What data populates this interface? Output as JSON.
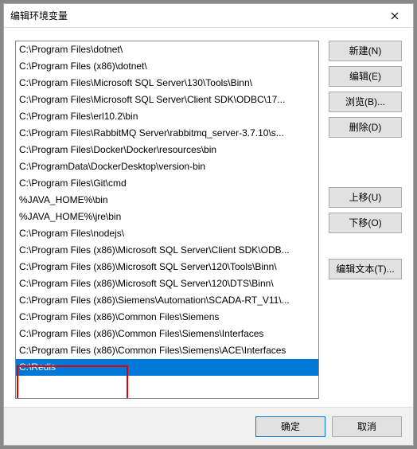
{
  "dialog": {
    "title": "编辑环境变量",
    "close_label": "×"
  },
  "entries": [
    "C:\\Program Files\\dotnet\\",
    "C:\\Program Files (x86)\\dotnet\\",
    "C:\\Program Files\\Microsoft SQL Server\\130\\Tools\\Binn\\",
    "C:\\Program Files\\Microsoft SQL Server\\Client SDK\\ODBC\\17...",
    "C:\\Program Files\\erl10.2\\bin",
    "C:\\Program Files\\RabbitMQ Server\\rabbitmq_server-3.7.10\\s...",
    "C:\\Program Files\\Docker\\Docker\\resources\\bin",
    "C:\\ProgramData\\DockerDesktop\\version-bin",
    "C:\\Program Files\\Git\\cmd",
    "%JAVA_HOME%\\bin",
    "%JAVA_HOME%\\jre\\bin",
    "C:\\Program Files\\nodejs\\",
    "C:\\Program Files (x86)\\Microsoft SQL Server\\Client SDK\\ODB...",
    "C:\\Program Files (x86)\\Microsoft SQL Server\\120\\Tools\\Binn\\",
    "C:\\Program Files (x86)\\Microsoft SQL Server\\120\\DTS\\Binn\\",
    "C:\\Program Files (x86)\\Siemens\\Automation\\SCADA-RT_V11\\...",
    "C:\\Program Files (x86)\\Common Files\\Siemens",
    "C:\\Program Files (x86)\\Common Files\\Siemens\\Interfaces",
    "C:\\Program Files (x86)\\Common Files\\Siemens\\ACE\\Interfaces",
    "C:\\Redis"
  ],
  "selected_index": 19,
  "buttons": {
    "new": "新建(N)",
    "edit": "编辑(E)",
    "browse": "浏览(B)...",
    "delete": "删除(D)",
    "move_up": "上移(U)",
    "move_down": "下移(O)",
    "edit_text": "编辑文本(T)...",
    "ok": "确定",
    "cancel": "取消"
  },
  "new_entry_value": ""
}
